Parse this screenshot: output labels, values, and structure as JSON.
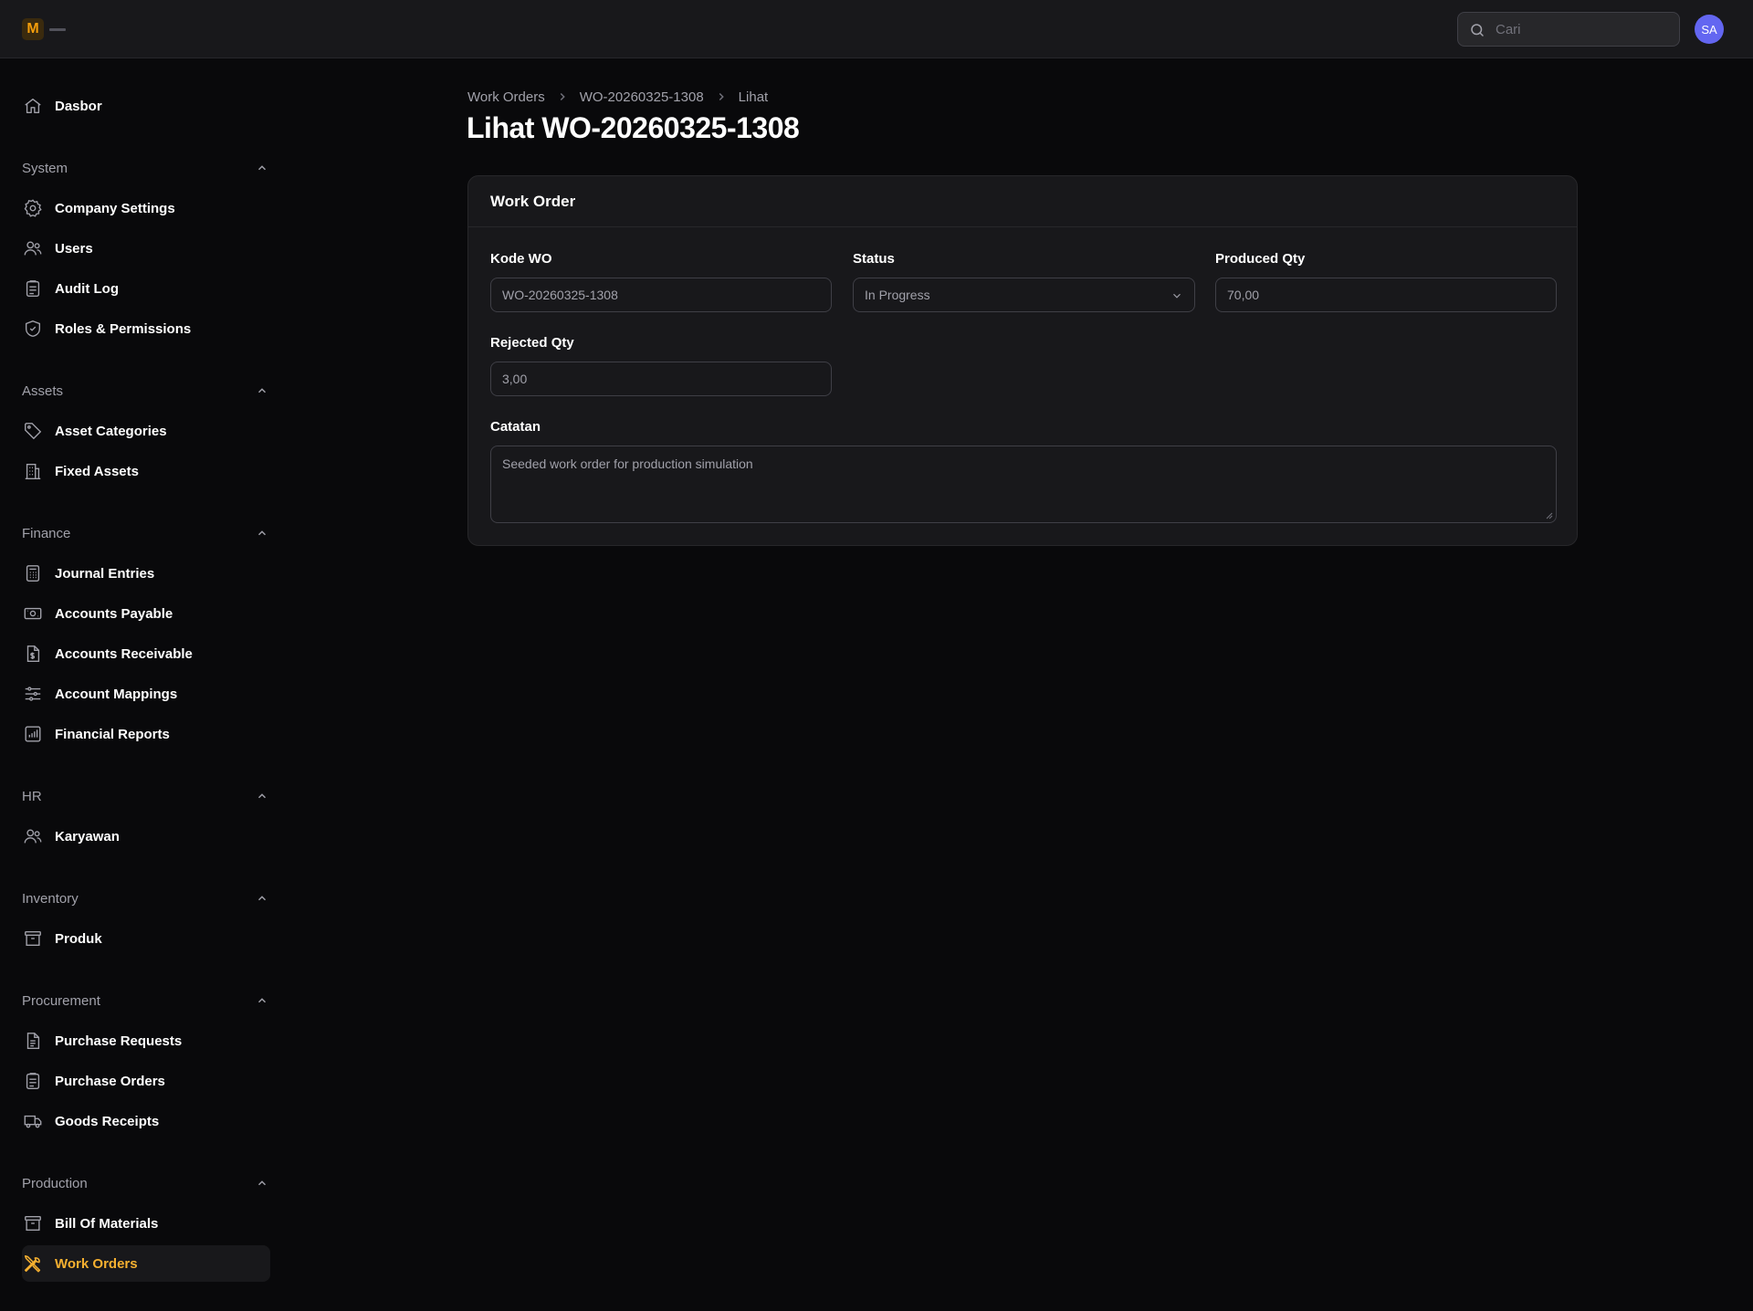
{
  "app": {
    "logo_letter": "M",
    "brand_color": "#f59e0b"
  },
  "topbar": {
    "search_placeholder": "Cari",
    "avatar_initials": "SA",
    "avatar_color": "#6366f1"
  },
  "sidebar": {
    "dashboard": "Dasbor",
    "groups": [
      {
        "title": "System",
        "items": [
          "Company Settings",
          "Users",
          "Audit Log",
          "Roles & Permissions"
        ]
      },
      {
        "title": "Assets",
        "items": [
          "Asset Categories",
          "Fixed Assets"
        ]
      },
      {
        "title": "Finance",
        "items": [
          "Journal Entries",
          "Accounts Payable",
          "Accounts Receivable",
          "Account Mappings",
          "Financial Reports"
        ]
      },
      {
        "title": "HR",
        "items": [
          "Karyawan"
        ]
      },
      {
        "title": "Inventory",
        "items": [
          "Produk"
        ]
      },
      {
        "title": "Procurement",
        "items": [
          "Purchase Requests",
          "Purchase Orders",
          "Goods Receipts"
        ]
      },
      {
        "title": "Production",
        "items": [
          "Bill Of Materials",
          "Work Orders"
        ]
      }
    ],
    "active_item": "Work Orders",
    "active_color": "#f5b030"
  },
  "breadcrumb": [
    "Work Orders",
    "WO-20260325-1308",
    "Lihat"
  ],
  "page": {
    "title": "Lihat WO-20260325-1308"
  },
  "card": {
    "title": "Work Order",
    "fields": {
      "kode_wo": {
        "label": "Kode WO",
        "value": "WO-20260325-1308"
      },
      "status": {
        "label": "Status",
        "value": "In Progress"
      },
      "produced_qty": {
        "label": "Produced Qty",
        "value": "70,00"
      },
      "rejected_qty": {
        "label": "Rejected Qty",
        "value": "3,00"
      },
      "catatan": {
        "label": "Catatan",
        "value": "Seeded work order for production simulation"
      }
    }
  }
}
